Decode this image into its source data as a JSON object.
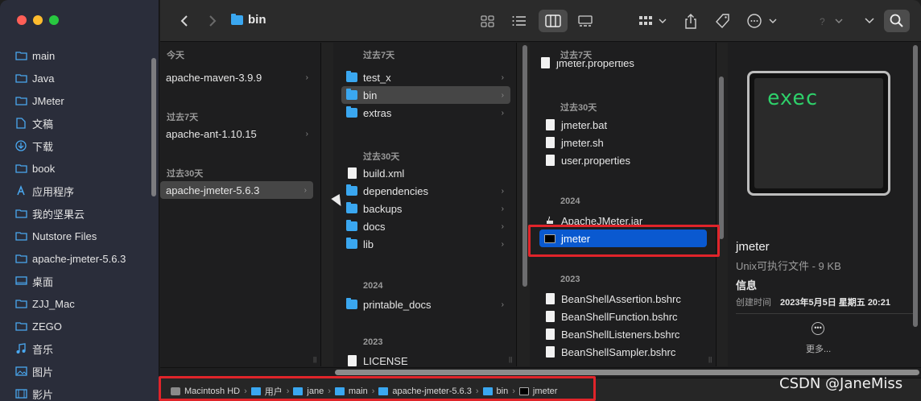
{
  "toolbar": {
    "title": "bin",
    "back_icon": "chevron-left-icon",
    "forward_icon": "chevron-right-icon",
    "view_icons": [
      "icon-view-icon",
      "list-view-icon",
      "column-view-icon",
      "gallery-view-icon"
    ],
    "group_icon": "group-icon",
    "share_icon": "share-icon",
    "tag_icon": "tag-icon",
    "more_icon": "ellipsis-circle-icon",
    "help_icon": "help-icon",
    "search_icon": "search-icon"
  },
  "sidebar": {
    "items": [
      {
        "label": "main",
        "icon": "folder-icon"
      },
      {
        "label": "Java",
        "icon": "folder-icon"
      },
      {
        "label": "JMeter",
        "icon": "folder-icon"
      },
      {
        "label": "文稿",
        "icon": "document-icon"
      },
      {
        "label": "下载",
        "icon": "download-icon"
      },
      {
        "label": "book",
        "icon": "folder-icon"
      },
      {
        "label": "应用程序",
        "icon": "apps-icon"
      },
      {
        "label": "我的坚果云",
        "icon": "folder-icon"
      },
      {
        "label": "Nutstore Files",
        "icon": "folder-icon"
      },
      {
        "label": "apache-jmeter-5.6.3",
        "icon": "folder-icon"
      },
      {
        "label": "桌面",
        "icon": "desktop-icon"
      },
      {
        "label": "ZJJ_Mac",
        "icon": "folder-icon"
      },
      {
        "label": "ZEGO",
        "icon": "folder-icon"
      },
      {
        "label": "音乐",
        "icon": "music-icon"
      },
      {
        "label": "图片",
        "icon": "photo-icon"
      },
      {
        "label": "影片",
        "icon": "film-icon"
      }
    ]
  },
  "col1": {
    "groups": [
      {
        "title": "今天",
        "items": [
          "apache-maven-3.9.9"
        ]
      },
      {
        "title": "过去7天",
        "items": [
          "apache-ant-1.10.15"
        ]
      },
      {
        "title": "过去30天",
        "items": [
          "apache-jmeter-5.6.3"
        ]
      }
    ]
  },
  "col2": {
    "groups": [
      {
        "title": "过去7天",
        "items": [
          "test_x",
          "bin",
          "extras"
        ]
      },
      {
        "title": "过去30天",
        "items": [
          "build.xml",
          "dependencies",
          "backups",
          "docs",
          "lib"
        ]
      },
      {
        "title": "2024",
        "items": [
          "printable_docs"
        ]
      },
      {
        "title": "2023",
        "items": [
          "LICENSE"
        ]
      }
    ]
  },
  "col3": {
    "groups": [
      {
        "title": "过去7天",
        "items": [
          "jmeter.properties"
        ]
      },
      {
        "title": "过去30天",
        "items": [
          "jmeter.bat",
          "jmeter.sh",
          "user.properties"
        ]
      },
      {
        "title": "2024",
        "items": [
          "ApacheJMeter.jar",
          "jmeter"
        ]
      },
      {
        "title": "2023",
        "items": [
          "BeanShellAssertion.bshrc",
          "BeanShellFunction.bshrc",
          "BeanShellListeners.bshrc",
          "BeanShellSampler.bshrc"
        ]
      }
    ]
  },
  "preview": {
    "thumb_text": "exec",
    "name": "jmeter",
    "kind": "Unix可执行文件 - 9 KB",
    "info": "信息",
    "created_label": "创建时间",
    "created_value": "2023年5月5日 星期五 20:21",
    "more": "更多..."
  },
  "pathbar": {
    "crumbs": [
      "Macintosh HD",
      "用户",
      "jane",
      "main",
      "apache-jmeter-5.6.3",
      "bin",
      "jmeter"
    ]
  },
  "watermark": "CSDN @JaneMiss",
  "colors": {
    "selection_blue": "#0a59d0",
    "highlight_red": "#e0242a",
    "folder_blue": "#3aa7f0"
  }
}
